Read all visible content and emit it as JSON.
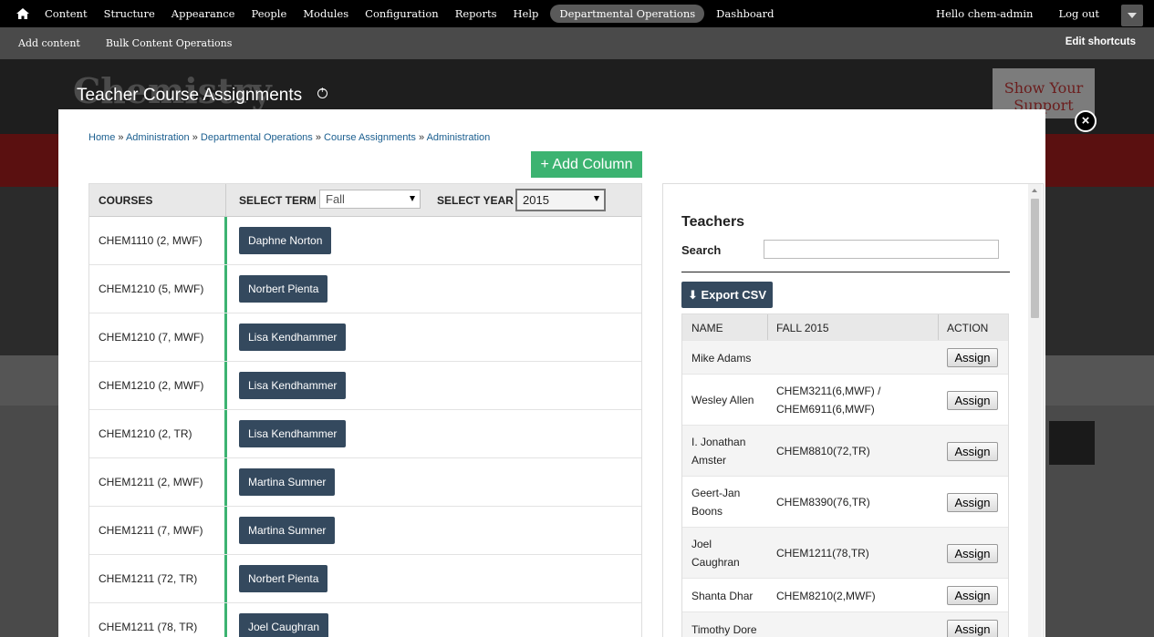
{
  "toolbar": {
    "menu": [
      "Content",
      "Structure",
      "Appearance",
      "People",
      "Modules",
      "Configuration",
      "Reports",
      "Help",
      "Departmental Operations",
      "Dashboard"
    ],
    "user_greeting": "Hello chem-admin",
    "logout": "Log out"
  },
  "shortcuts": {
    "items": [
      "Add content",
      "Bulk Content Operations"
    ],
    "edit": "Edit shortcuts"
  },
  "background": {
    "logo_text": "Chemistry",
    "support_text": "Show Your Support"
  },
  "page_title": "Teacher Course Assignments",
  "overlay": {
    "close": "×",
    "breadcrumb": [
      "Home",
      "Administration",
      "Departmental Operations",
      "Course Assignments",
      "Administration"
    ],
    "add_column": "+ Add Column",
    "courses": {
      "header": "COURSES",
      "term_label": "SELECT TERM",
      "term_value": "Fall",
      "year_label": "SELECT YEAR",
      "year_value": "2015",
      "rows": [
        {
          "course": "CHEM1110 (2, MWF)",
          "teacher": "Daphne Norton"
        },
        {
          "course": "CHEM1210 (5, MWF)",
          "teacher": "Norbert Pienta"
        },
        {
          "course": "CHEM1210 (7, MWF)",
          "teacher": "Lisa Kendhammer"
        },
        {
          "course": "CHEM1210 (2, MWF)",
          "teacher": "Lisa Kendhammer"
        },
        {
          "course": "CHEM1210 (2, TR)",
          "teacher": "Lisa Kendhammer"
        },
        {
          "course": "CHEM1211 (2, MWF)",
          "teacher": "Martina Sumner"
        },
        {
          "course": "CHEM1211 (7, MWF)",
          "teacher": "Martina Sumner"
        },
        {
          "course": "CHEM1211 (72, TR)",
          "teacher": "Norbert Pienta"
        },
        {
          "course": "CHEM1211 (78, TR)",
          "teacher": "Joel Caughran"
        }
      ]
    },
    "teachers": {
      "title": "Teachers",
      "search_label": "Search",
      "export": "⬇ Export CSV",
      "columns": [
        "NAME",
        "FALL 2015",
        "ACTION"
      ],
      "assign_label": "Assign",
      "rows": [
        {
          "name": [
            "Mike Adams"
          ],
          "assignments": []
        },
        {
          "name": [
            "Wesley Allen"
          ],
          "assignments": [
            "CHEM3211(6,MWF) /",
            "CHEM6911(6,MWF)"
          ]
        },
        {
          "name": [
            "I. Jonathan",
            "Amster"
          ],
          "assignments": [
            "CHEM8810(72,TR)"
          ]
        },
        {
          "name": [
            "Geert-Jan",
            "Boons"
          ],
          "assignments": [
            "CHEM8390(76,TR)"
          ]
        },
        {
          "name": [
            "Joel",
            "Caughran"
          ],
          "assignments": [
            "CHEM1211(78,TR)"
          ]
        },
        {
          "name": [
            "Shanta Dhar"
          ],
          "assignments": [
            "CHEM8210(2,MWF)"
          ]
        },
        {
          "name": [
            "Timothy Dore"
          ],
          "assignments": []
        }
      ]
    }
  }
}
